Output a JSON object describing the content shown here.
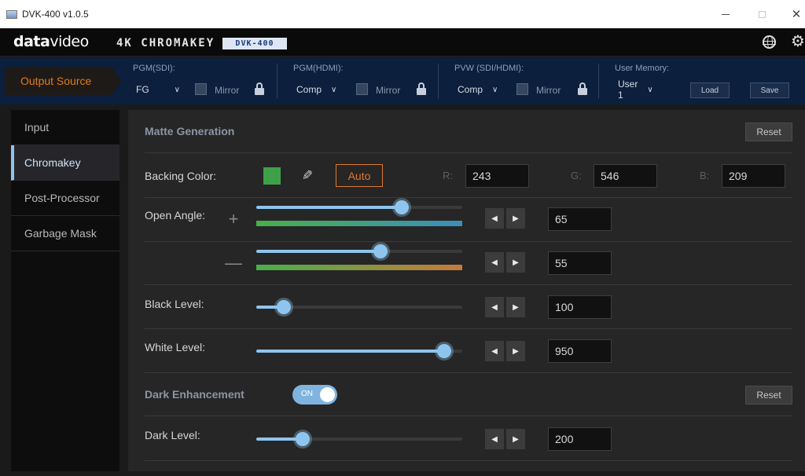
{
  "window": {
    "title": "DVK-400 v1.0.5",
    "minimize_glyph": "—",
    "close_glyph": "✕"
  },
  "brand": {
    "logo_bold": "data",
    "logo_light": "video",
    "product": "4K CHROMAKEY",
    "badge": "DVK-400"
  },
  "icons": {
    "globe": "globe-icon",
    "settings": "gear-icon",
    "lock": "lock-icon",
    "eyedropper": "eyedropper-icon",
    "plus": "plus-icon",
    "minus": "minus-icon"
  },
  "output_bar": {
    "output_source": "Output Source",
    "pgm_sdi": {
      "label": "PGM(SDI):",
      "value": "FG",
      "mirror": "Mirror"
    },
    "pgm_hdmi": {
      "label": "PGM(HDMI):",
      "value": "Comp",
      "mirror": "Mirror"
    },
    "pvw": {
      "label": "PVW (SDI/HDMI):",
      "value": "Comp",
      "mirror": "Mirror"
    },
    "user_memory": {
      "label": "User Memory:",
      "value": "User 1",
      "load": "Load",
      "save": "Save"
    }
  },
  "sidebar": {
    "items": [
      {
        "label": "Input",
        "active": false
      },
      {
        "label": "Chromakey",
        "active": true
      },
      {
        "label": "Post-Processor",
        "active": false
      },
      {
        "label": "Garbage Mask",
        "active": false
      }
    ]
  },
  "matte": {
    "title": "Matte Generation",
    "reset": "Reset",
    "backing_color": {
      "label": "Backing Color:",
      "color": "#3ea14a",
      "auto": "Auto",
      "r_label": "R:",
      "r": "243",
      "g_label": "G:",
      "g": "546",
      "b_label": "B:",
      "b": "209"
    },
    "open_angle": {
      "label": "Open Angle:",
      "plus_glyph": "+",
      "minus_glyph": "—",
      "plus_value": "65",
      "minus_value": "55"
    },
    "black_level": {
      "label": "Black Level:",
      "value": "100"
    },
    "white_level": {
      "label": "White Level:",
      "value": "950"
    }
  },
  "dark": {
    "title": "Dark Enhancement",
    "toggle": "ON",
    "reset": "Reset",
    "dark_level": {
      "label": "Dark Level:",
      "value": "200"
    }
  },
  "stepper": {
    "left_glyph": "◀",
    "right_glyph": "▶"
  },
  "colors": {
    "accent": "#e0782a",
    "slider": "#8ec5ee",
    "panel": "#262626",
    "nav_bg": "#0d0d0d",
    "bar_bg": "#0c1f3c"
  }
}
